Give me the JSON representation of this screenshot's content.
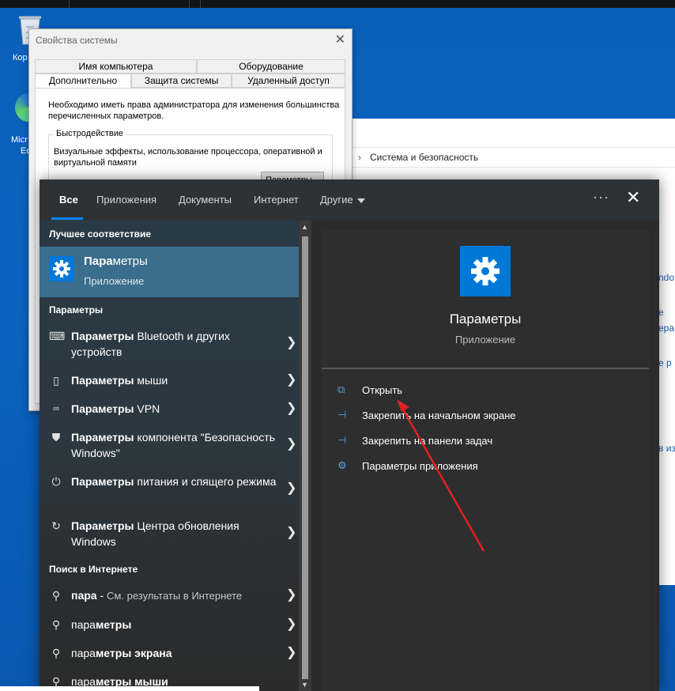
{
  "desktop": {
    "recycle_label": "Кор",
    "edge_label_1": "Micr",
    "edge_label_2": "Ec"
  },
  "control_panel": {
    "breadcrumb": "Система и безопасность",
    "side_links": [
      "ndo",
      "е",
      "ера",
      "е р",
      "в из"
    ]
  },
  "system_properties": {
    "title": "Свойства системы",
    "tabs_top": [
      "Имя компьютера",
      "Оборудование"
    ],
    "tabs_bottom": [
      "Дополнительно",
      "Защита системы",
      "Удаленный доступ"
    ],
    "note": "Необходимо иметь права администратора для изменения большинства перечисленных параметров.",
    "performance_title": "Быстродействие",
    "performance_text": "Визуальные эффекты, использование процессора, оперативной и виртуальной памяти",
    "params_button": "Параметры..."
  },
  "search": {
    "tabs": [
      "Все",
      "Приложения",
      "Документы",
      "Интернет",
      "Другие"
    ],
    "more_label": "···",
    "close_label": "✕",
    "best_match_title": "Лучшее соответствие",
    "best_match": {
      "name_bold": "Пара",
      "name_rest": "метры",
      "type": "Приложение"
    },
    "settings_title": "Параметры",
    "settings_items": [
      {
        "bold": "Параметры",
        "rest": " Bluetooth и других устройств",
        "icon": "keyboard-icon"
      },
      {
        "bold": "Параметры",
        "rest": " мыши",
        "icon": "mouse-icon"
      },
      {
        "bold": "Параметры",
        "rest": " VPN",
        "icon": "vpn-icon"
      },
      {
        "bold": "Параметры",
        "rest": " компонента \"Безопасность Windows\"",
        "icon": "shield-icon"
      },
      {
        "bold": "Параметры",
        "rest": " питания и спящего режима",
        "icon": "power-icon"
      },
      {
        "bold": "Параметры",
        "rest": " Центра обновления Windows",
        "icon": "refresh-icon"
      }
    ],
    "web_title": "Поиск в Интернете",
    "web_items": [
      {
        "bold": "пара",
        "rest": " - ",
        "hint": "См. результаты в Интернете"
      },
      {
        "bold": "пара",
        "rest": "метры",
        "hint": ""
      },
      {
        "bold": "пара",
        "rest": "метры экрана",
        "hint": ""
      },
      {
        "bold": "пара",
        "rest": "метры мыши",
        "hint": ""
      }
    ],
    "detail": {
      "title": "Параметры",
      "subtitle": "Приложение",
      "actions": [
        {
          "label": "Открыть",
          "icon": "open-icon"
        },
        {
          "label": "Закрепить на начальном экране",
          "icon": "pin-icon"
        },
        {
          "label": "Закрепить на панели задач",
          "icon": "pin-icon"
        },
        {
          "label": "Параметры приложения",
          "icon": "gear-icon"
        }
      ]
    }
  },
  "colors": {
    "accent": "#0078d7",
    "arrow": "#e02020"
  }
}
